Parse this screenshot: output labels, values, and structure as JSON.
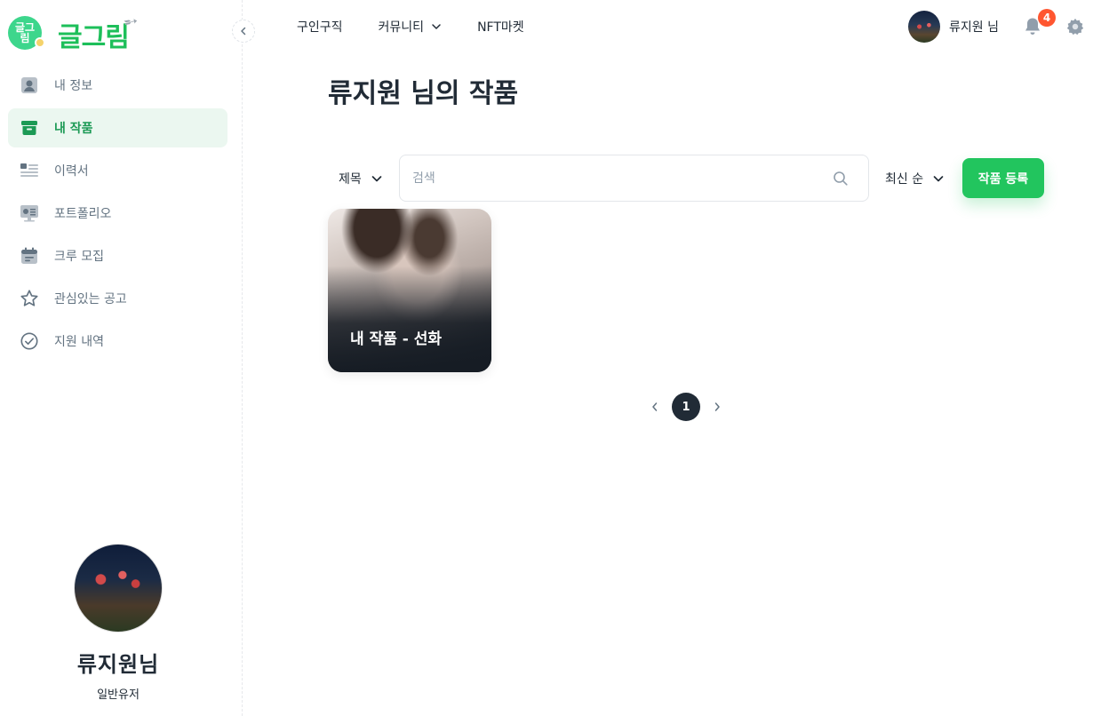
{
  "brand": {
    "badge_text": "글그\n림",
    "logo_text": "글그림"
  },
  "sidebar": {
    "items": [
      {
        "label": "내 정보",
        "icon": "user-square-icon",
        "active": false
      },
      {
        "label": "내 작품",
        "icon": "archive-icon",
        "active": true
      },
      {
        "label": "이력서",
        "icon": "resume-list-icon",
        "active": false
      },
      {
        "label": "포트폴리오",
        "icon": "portfolio-monitor-icon",
        "active": false
      },
      {
        "label": "크루 모집",
        "icon": "calendar-icon",
        "active": false
      },
      {
        "label": "관심있는 공고",
        "icon": "star-icon",
        "active": false
      },
      {
        "label": "지원 내역",
        "icon": "check-circle-icon",
        "active": false
      }
    ],
    "profile": {
      "name": "류지원님",
      "role": "일반유저"
    }
  },
  "header": {
    "nav": [
      {
        "label": "구인구직",
        "has_dropdown": false
      },
      {
        "label": "커뮤니티",
        "has_dropdown": true
      },
      {
        "label": "NFT마켓",
        "has_dropdown": false
      }
    ],
    "user_name": "류지원 님",
    "notification_count": "4"
  },
  "main": {
    "title": "류지원 님의 작품",
    "filter": {
      "selected": "제목"
    },
    "search": {
      "placeholder": "검색",
      "value": ""
    },
    "sort": {
      "selected": "최신 순"
    },
    "register_label": "작품 등록",
    "cards": [
      {
        "title": "내 작품 - 선화"
      }
    ],
    "pagination": {
      "current": "1"
    }
  },
  "colors": {
    "accent": "#22c55e",
    "active_text": "#1c9a55",
    "active_bg": "#ebf7f0",
    "badge": "#ff5630",
    "text": "#212b36",
    "muted": "#637381"
  }
}
